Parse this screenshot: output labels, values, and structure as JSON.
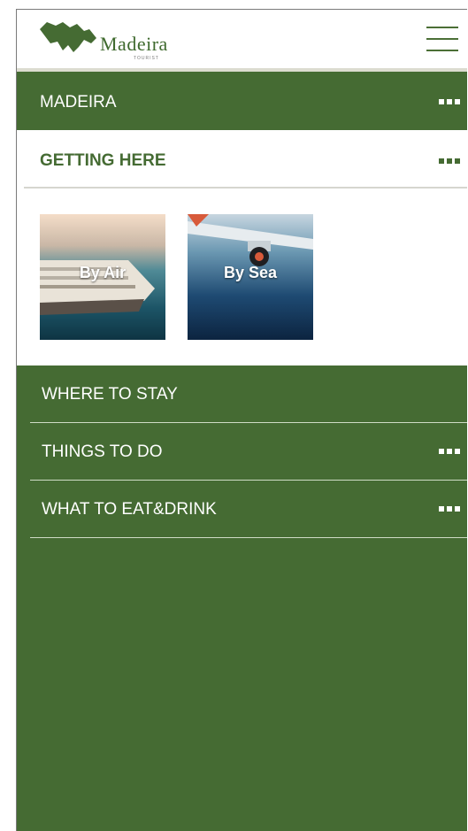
{
  "header": {
    "logo_main": "Madeira",
    "logo_sub": "TOURIST",
    "logo_icon": "madeira-island-icon",
    "menu_icon": "hamburger-icon"
  },
  "menu": {
    "top": {
      "label": "MADEIRA",
      "more_icon": "more-dots-icon"
    },
    "getting_here": {
      "label": "GETTING HERE",
      "more_icon": "more-dots-icon",
      "cards": [
        {
          "label": "By Air",
          "image": "cruise-ship-photo"
        },
        {
          "label": "By Sea",
          "image": "airplane-wing-photo"
        }
      ]
    },
    "items": [
      {
        "label": "WHERE TO STAY"
      },
      {
        "label": "THINGS TO DO",
        "more_icon": "more-dots-icon"
      },
      {
        "label": "WHAT TO EAT&DRINK",
        "more_icon": "more-dots-icon"
      }
    ]
  },
  "colors": {
    "brand_green": "#456b33",
    "white": "#ffffff",
    "divider": "#d6d6cf"
  }
}
